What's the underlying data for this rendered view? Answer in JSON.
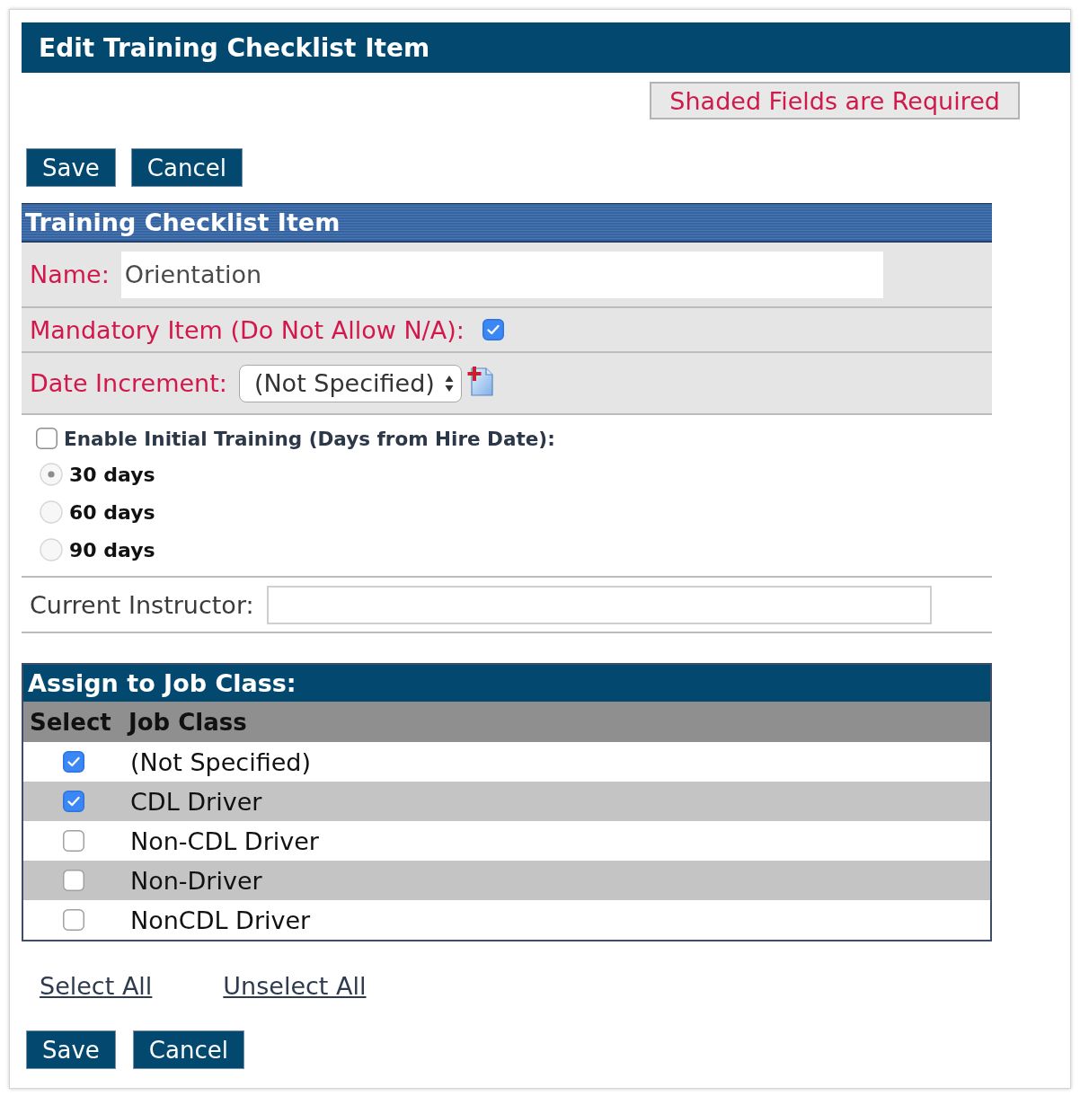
{
  "window": {
    "title": "Edit Training Checklist Item"
  },
  "required_note": {
    "text": "Shaded Fields are Required"
  },
  "top_buttons": [
    {
      "label": "Save"
    },
    {
      "label": "Cancel"
    }
  ],
  "checklist_section": {
    "title": "Training Checklist Item",
    "fields": [
      {
        "kind": "text",
        "label": "Name:",
        "value": "Orientation",
        "required": true
      },
      {
        "kind": "checkbox",
        "label": "Mandatory Item (Do Not Allow N/A):",
        "checked": true,
        "required": true
      },
      {
        "kind": "select",
        "label": "Date Increment:",
        "value": "(Not Specified)",
        "required": true
      }
    ]
  },
  "initial_training": {
    "label": "Enable Initial Training (Days from Hire Date):",
    "checked": false,
    "options": [
      {
        "label": "30 days",
        "selected": true
      },
      {
        "label": "60 days",
        "selected": false
      },
      {
        "label": "90 days",
        "selected": false
      }
    ]
  },
  "instructor_field": {
    "label": "Current Instructor:",
    "required": false
  },
  "job_class_table": {
    "title": "Assign to Job Class:",
    "columns": [
      "Select",
      "Job Class"
    ],
    "rows": [
      {
        "name": "(Not Specified)",
        "checked": true
      },
      {
        "name": "CDL Driver",
        "checked": true
      },
      {
        "name": "Non-CDL Driver",
        "checked": false
      },
      {
        "name": "Non-Driver",
        "checked": false
      },
      {
        "name": "NonCDL Driver",
        "checked": false
      }
    ]
  },
  "links": [
    "Select All",
    "Unselect All"
  ],
  "bottom_buttons": [
    {
      "label": "Save"
    },
    {
      "label": "Cancel"
    }
  ]
}
